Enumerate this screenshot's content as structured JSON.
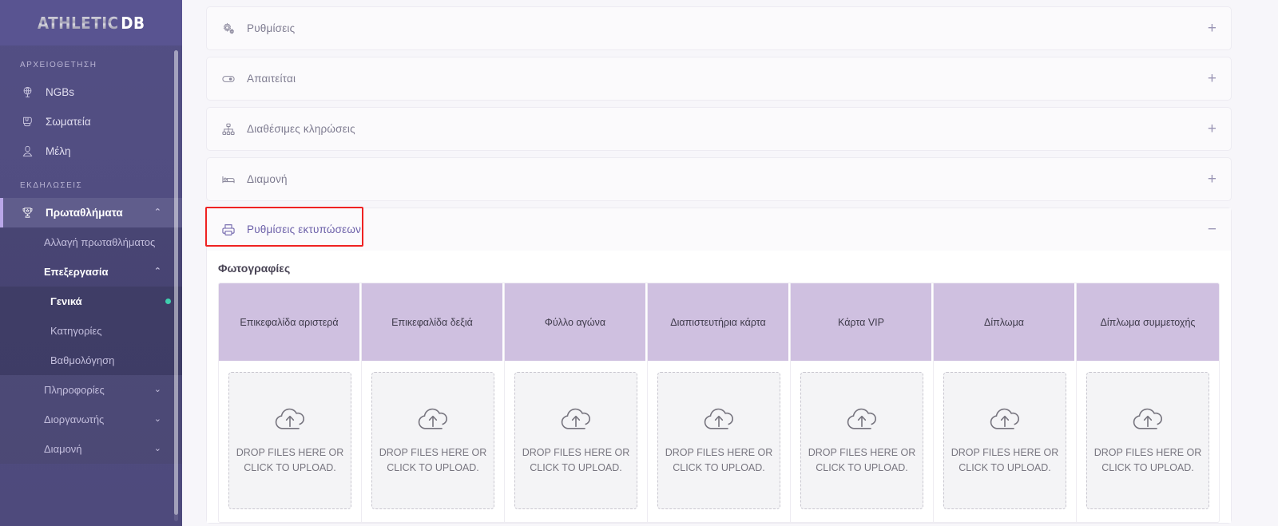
{
  "brand": {
    "part1": "ATHLETIC",
    "part2": "DB"
  },
  "sidebar": {
    "sections": [
      {
        "label": "ΑΡΧΕΙΟΘΕΤΗΣΗ",
        "items": [
          {
            "label": "NGBs",
            "icon": "globe-icon"
          },
          {
            "label": "Σωματεία",
            "icon": "boxing-glove-icon"
          },
          {
            "label": "Μέλη",
            "icon": "member-icon"
          }
        ]
      },
      {
        "label": "ΕΚΔΗΛΩΣΕΙΣ",
        "items": [
          {
            "label": "Πρωταθλήματα",
            "icon": "trophy-icon",
            "chevron": "⌃"
          }
        ]
      }
    ],
    "sub_items": [
      {
        "label": "Αλλαγή πρωταθλήματος"
      },
      {
        "label": "Επεξεργασία",
        "chevron": "⌃"
      }
    ],
    "edit_children": [
      {
        "label": "Γενικά",
        "current": true
      },
      {
        "label": "Κατηγορίες",
        "current": false
      },
      {
        "label": "Βαθμολόγηση",
        "current": false
      }
    ],
    "tail_items": [
      {
        "label": "Πληροφορίες",
        "chevron": "⌄"
      },
      {
        "label": "Διοργανωτής",
        "chevron": "⌄"
      },
      {
        "label": "Διαμονή",
        "chevron": "⌄"
      }
    ]
  },
  "main": {
    "panels": [
      {
        "title": "Ρυθμίσεις",
        "icon": "gear-icon",
        "sign": "+",
        "expanded": false
      },
      {
        "title": "Απαιτείται",
        "icon": "toggle-icon",
        "sign": "+",
        "expanded": false
      },
      {
        "title": "Διαθέσιμες κληρώσεις",
        "icon": "sitemap-icon",
        "sign": "+",
        "expanded": false
      },
      {
        "title": "Διαμονή",
        "icon": "bed-icon",
        "sign": "+",
        "expanded": false
      },
      {
        "title": "Ρυθμίσεις εκτυπώσεων",
        "icon": "printer-icon",
        "sign": "−",
        "expanded": true
      }
    ],
    "photos_section_title": "Φωτογραφίες",
    "photo_columns": [
      "Επικεφαλίδα αριστερά",
      "Επικεφαλίδα δεξιά",
      "Φύλλο αγώνα",
      "Διαπιστευτήρια κάρτα",
      "Κάρτα VIP",
      "Δίπλωμα",
      "Δίπλωμα συμμετοχής"
    ],
    "dropzone_text": "Drop files here or click to upload.",
    "dropzone_icon": "cloud-upload-icon"
  },
  "colors": {
    "sidebar_bg": "#534f84",
    "accent_purple": "#6b5fa8",
    "table_header": "#cfc0e0",
    "highlight_border": "#ef2222",
    "active_dot": "#3fcfae",
    "page_bg": "#f7f6fa"
  }
}
